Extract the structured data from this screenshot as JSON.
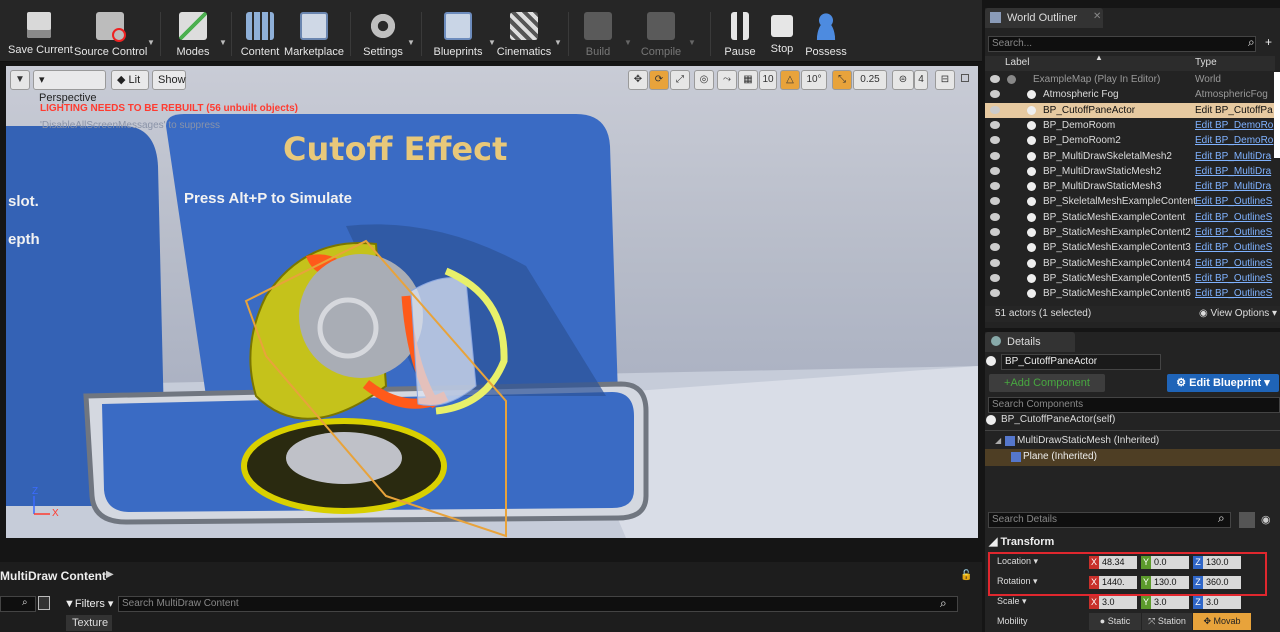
{
  "toolbar": {
    "buttons": [
      {
        "label": "Save Current",
        "icon": "save-icon",
        "enabled": true
      },
      {
        "label": "Source Control",
        "icon": "source-control-icon",
        "enabled": true
      },
      {
        "label": "Modes",
        "icon": "modes-icon",
        "enabled": true
      },
      {
        "label": "Content",
        "icon": "content-icon",
        "enabled": true
      },
      {
        "label": "Marketplace",
        "icon": "marketplace-icon",
        "enabled": true
      },
      {
        "label": "Settings",
        "icon": "settings-icon",
        "enabled": true
      },
      {
        "label": "Blueprints",
        "icon": "blueprints-icon",
        "enabled": true
      },
      {
        "label": "Cinematics",
        "icon": "cinematics-icon",
        "enabled": true
      },
      {
        "label": "Build",
        "icon": "build-icon",
        "enabled": false
      },
      {
        "label": "Compile",
        "icon": "compile-icon",
        "enabled": false
      },
      {
        "label": "Pause",
        "icon": "pause-icon",
        "enabled": true
      },
      {
        "label": "Stop",
        "icon": "stop-icon",
        "enabled": true
      },
      {
        "label": "Possess",
        "icon": "possess-icon",
        "enabled": true
      }
    ]
  },
  "viewport": {
    "perspective_label": "Perspective",
    "lit_label": "Lit",
    "show_label": "Show",
    "warning": "LIGHTING NEEDS TO BE REBUILT (56 unbuilt objects)",
    "warning_sub": "'DisableAllScreenMessages' to suppress",
    "scene_title": "Cutoff Effect",
    "scene_hint": "Press Alt+P to Simulate",
    "left_text_1": "slot.",
    "left_text_2": "epth",
    "grid_snap": "10",
    "rot_snap": "10°",
    "scale_snap": "0.25",
    "cam_speed": "4",
    "axis_z": "Z",
    "axis_x": "X"
  },
  "outliner": {
    "tab_label": "World Outliner",
    "search_placeholder": "Search...",
    "col_label": "Label",
    "col_type": "Type",
    "rows": [
      {
        "name": "ExampleMap (Play In Editor)",
        "type": "World",
        "style": "world"
      },
      {
        "name": "Atmospheric Fog",
        "type": "AtmosphericFog",
        "style": "plain"
      },
      {
        "name": "BP_CutoffPaneActor",
        "type": "Edit BP_CutoffPa",
        "style": "selected"
      },
      {
        "name": "BP_DemoRoom",
        "type": "Edit BP_DemoRo",
        "style": "link"
      },
      {
        "name": "BP_DemoRoom2",
        "type": "Edit BP_DemoRo",
        "style": "link"
      },
      {
        "name": "BP_MultiDrawSkeletalMesh2",
        "type": "Edit BP_MultiDra",
        "style": "link"
      },
      {
        "name": "BP_MultiDrawStaticMesh2",
        "type": "Edit BP_MultiDra",
        "style": "link"
      },
      {
        "name": "BP_MultiDrawStaticMesh3",
        "type": "Edit BP_MultiDra",
        "style": "link"
      },
      {
        "name": "BP_SkeletalMeshExampleContent",
        "type": "Edit BP_OutlineS",
        "style": "link"
      },
      {
        "name": "BP_StaticMeshExampleContent",
        "type": "Edit BP_OutlineS",
        "style": "link"
      },
      {
        "name": "BP_StaticMeshExampleContent2",
        "type": "Edit BP_OutlineS",
        "style": "link"
      },
      {
        "name": "BP_StaticMeshExampleContent3",
        "type": "Edit BP_OutlineS",
        "style": "link"
      },
      {
        "name": "BP_StaticMeshExampleContent4",
        "type": "Edit BP_OutlineS",
        "style": "link"
      },
      {
        "name": "BP_StaticMeshExampleContent5",
        "type": "Edit BP_OutlineS",
        "style": "link"
      },
      {
        "name": "BP_StaticMeshExampleContent6",
        "type": "Edit BP_OutlineS",
        "style": "link"
      }
    ],
    "status": "51 actors (1 selected)",
    "view_options": "View Options"
  },
  "details": {
    "tab_label": "Details",
    "actor_name": "BP_CutoffPaneActor",
    "add_component": "+Add Component",
    "edit_blueprint": "Edit Blueprint",
    "search_components": "Search Components",
    "self_component": "BP_CutoffPaneActor(self)",
    "component_1": "MultiDrawStaticMesh (Inherited)",
    "component_2": "Plane (Inherited)",
    "search_details": "Search Details",
    "transform_label": "Transform",
    "location_label": "Location",
    "rotation_label": "Rotation",
    "scale_label": "Scale",
    "mobility_label": "Mobility",
    "location": {
      "x": "48.34",
      "y": "0.0",
      "z": "130.0"
    },
    "rotation": {
      "x": "1440.",
      "y": "130.0",
      "z": "360.0"
    },
    "scale": {
      "x": "3.0",
      "y": "3.0",
      "z": "3.0"
    },
    "mobility_options": [
      "Static",
      "Station",
      "Movab"
    ]
  },
  "content": {
    "title": "MultiDraw Content",
    "filters_label": "Filters",
    "search_placeholder": "Search MultiDraw Content",
    "filter_chip": "Texture"
  },
  "colors": {
    "accent_orange": "#e8a33b",
    "highlight_red": "#e0272e",
    "link_blue": "#7fb2ff",
    "warning_red": "#ff3b30",
    "edit_blueprint_blue": "#1f64b8"
  }
}
